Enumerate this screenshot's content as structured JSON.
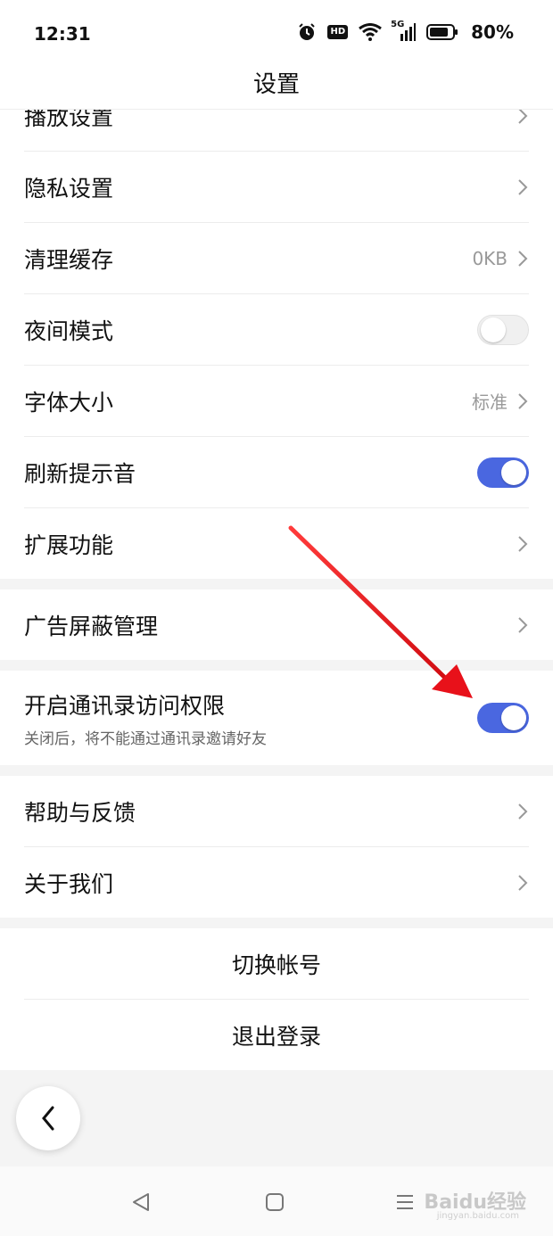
{
  "status_bar": {
    "time": "12:31",
    "hd_label": "HD",
    "network_label": "5G",
    "battery": "80%"
  },
  "header": {
    "title": "设置"
  },
  "settings": {
    "playback": {
      "label": "播放设置"
    },
    "privacy": {
      "label": "隐私设置"
    },
    "clear_cache": {
      "label": "清理缓存",
      "value": "0KB"
    },
    "night_mode": {
      "label": "夜间模式",
      "enabled": false
    },
    "font_size": {
      "label": "字体大小",
      "value": "标准"
    },
    "refresh_sound": {
      "label": "刷新提示音",
      "enabled": true
    },
    "extensions": {
      "label": "扩展功能"
    },
    "ad_block": {
      "label": "广告屏蔽管理"
    },
    "contacts_access": {
      "label": "开启通讯录访问权限",
      "subtitle": "关闭后，将不能通过通讯录邀请好友",
      "enabled": true
    },
    "help": {
      "label": "帮助与反馈"
    },
    "about": {
      "label": "关于我们"
    },
    "switch_account": {
      "label": "切换帐号"
    },
    "logout": {
      "label": "退出登录"
    }
  },
  "watermark": {
    "text": "Baidu经验",
    "url": "jingyan.baidu.com"
  },
  "colors": {
    "accent": "#4a67e0",
    "annotation_arrow": "#e8111a"
  }
}
